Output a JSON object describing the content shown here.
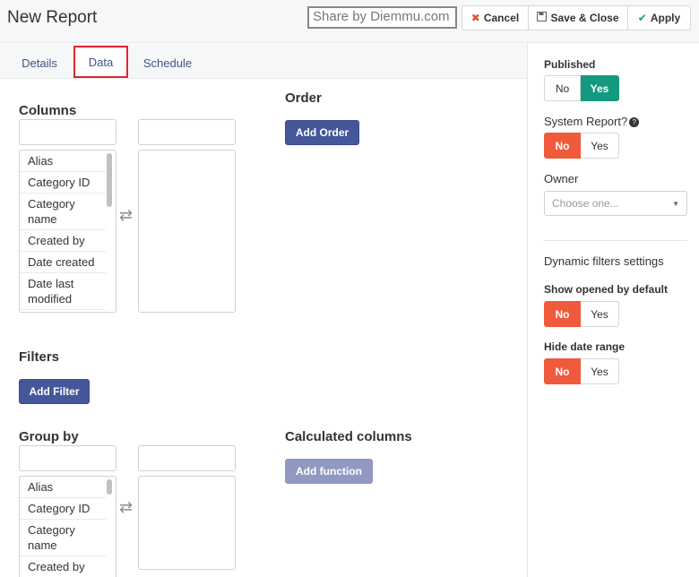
{
  "header": {
    "title": "New Report",
    "share_text": "Share by Diemmu.com",
    "cancel_label": "Cancel",
    "save_label": "Save & Close",
    "apply_label": "Apply"
  },
  "tabs": [
    {
      "label": "Details"
    },
    {
      "label": "Data"
    },
    {
      "label": "Schedule"
    }
  ],
  "columns": {
    "title": "Columns",
    "items": [
      "Alias",
      "Category ID",
      "Category name",
      "Created by",
      "Date created",
      "Date last modified"
    ]
  },
  "order": {
    "title": "Order",
    "button_label": "Add Order"
  },
  "filters": {
    "title": "Filters",
    "button_label": "Add Filter"
  },
  "group_by": {
    "title": "Group by",
    "items": [
      "Alias",
      "Category ID",
      "Category name",
      "Created by"
    ]
  },
  "calculated": {
    "title": "Calculated columns",
    "button_label": "Add function"
  },
  "sidebar": {
    "published": {
      "label": "Published",
      "no": "No",
      "yes": "Yes",
      "selected": "Yes"
    },
    "system_report": {
      "label": "System Report?",
      "no": "No",
      "yes": "Yes",
      "selected": "No"
    },
    "owner": {
      "label": "Owner",
      "placeholder": "Choose one..."
    },
    "dynamic_filters": {
      "label": "Dynamic filters settings"
    },
    "show_opened": {
      "label": "Show opened by default",
      "no": "No",
      "yes": "Yes",
      "selected": "No"
    },
    "hide_date_range": {
      "label": "Hide date range",
      "no": "No",
      "yes": "Yes",
      "selected": "No"
    }
  },
  "colors": {
    "primary": "#45579b",
    "green": "#13997f",
    "red": "#ef5a3c",
    "tab_highlight": "#e0262d"
  }
}
